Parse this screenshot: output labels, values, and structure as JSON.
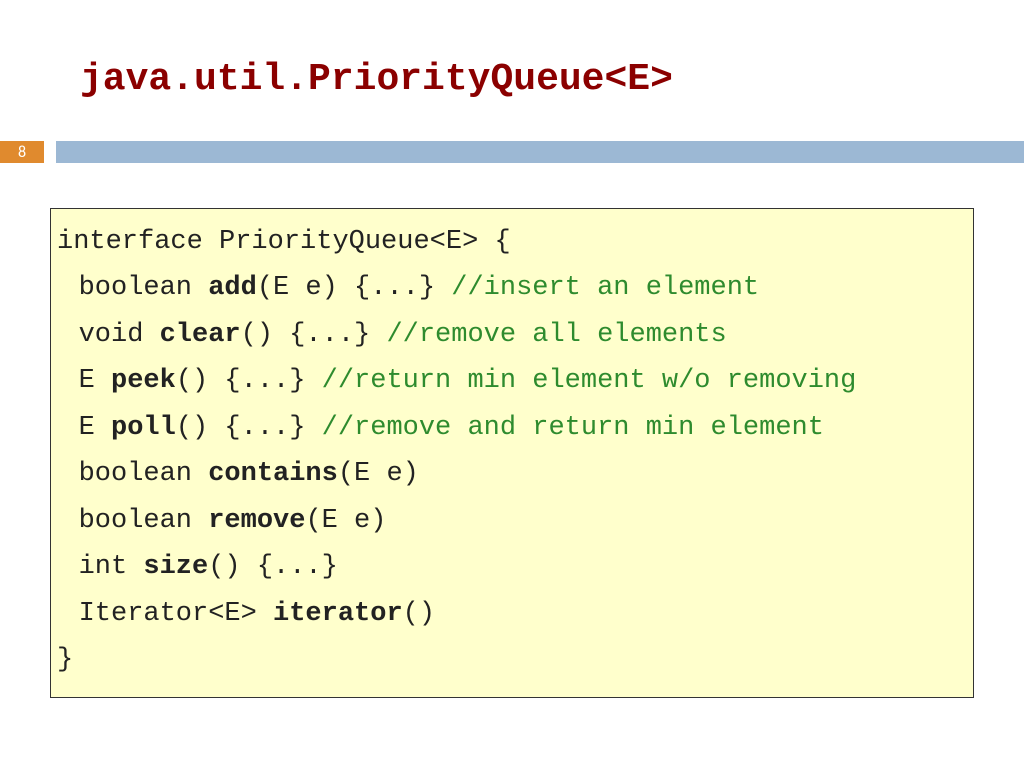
{
  "title": "java.util.PriorityQueue<E>",
  "page_number": "8",
  "code": {
    "l0": "interface PriorityQueue<E> {",
    "l1_pre": "boolean ",
    "l1_kw": "add",
    "l1_post": "(E e) {...} ",
    "l1_cm": "//insert an element",
    "l2_pre": "void ",
    "l2_kw": "clear",
    "l2_post": "() {...} ",
    "l2_cm": "//remove all elements",
    "l3_pre": "E ",
    "l3_kw": "peek",
    "l3_post": "() {...} ",
    "l3_cm": "//return min element w/o removing",
    "l4_pre": "E ",
    "l4_kw": "poll",
    "l4_post": "() {...} ",
    "l4_cm": "//remove and return min element",
    "l5_pre": "boolean ",
    "l5_kw": "contains",
    "l5_post": "(E e)",
    "l6_pre": "boolean ",
    "l6_kw": "remove",
    "l6_post": "(E e)",
    "l7_pre": "int ",
    "l7_kw": "size",
    "l7_post": "() {...}",
    "l8_pre": "Iterator<E> ",
    "l8_kw": "iterator",
    "l8_post": "()",
    "l9": "}"
  }
}
